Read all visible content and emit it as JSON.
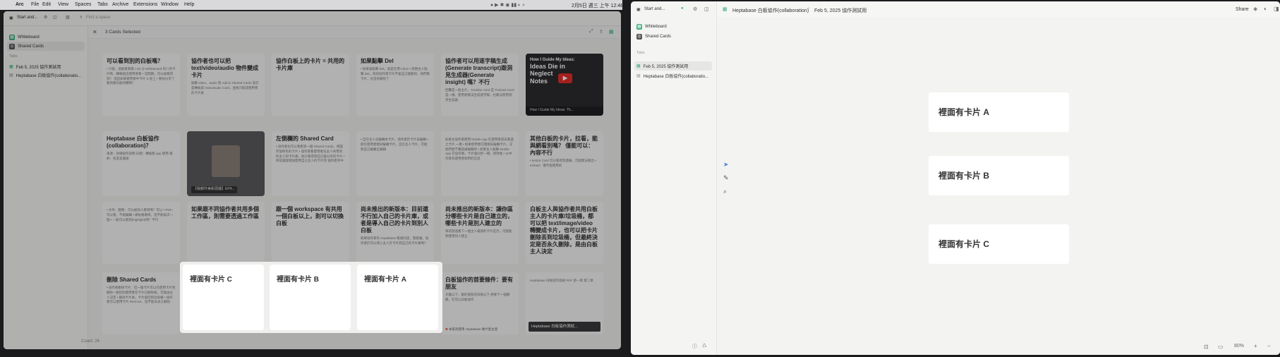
{
  "menubar": {
    "items": [
      "Arc",
      "File",
      "Edit",
      "View",
      "Spaces",
      "Tabs",
      "Archive",
      "Extensions",
      "Window",
      "Help"
    ],
    "clock": "2月5日 週三 上午 12:48"
  },
  "left": {
    "space_name": "Start and...",
    "search_placeholder": "Find a space",
    "sidebar": {
      "items": [
        "Whiteboard",
        "Shared Cards"
      ],
      "tabs_label": "Tabs",
      "tabs": [
        "Feb 5, 2025 協作測試用",
        "Heptabase 白板協作(collaboratio..."
      ]
    },
    "selection": {
      "label": "3 Cards Selected"
    },
    "footer": {
      "count": "Count: 24"
    },
    "cards": [
      {
        "t": "可以看到別的白板嗎？",
        "b": "• 只能，他能看我看 Link 分 Whiteboard 的八的卡片嗎，轉要給這使用者看 • 沒問題，可以被看得到？ 但但如果使用者中卡片 S 從上 • 要則分享了看到看白板的機嗎？"
      },
      {
        "t": "協作者也可以把 text/video/audio 物件變成卡片",
        "b": "點擊 video、audio 到 Add to Shared Cards 等於是轉換成 Video/audio Card，並後只能該使用者的卡片後"
      },
      {
        "t": "協作白板上的卡片 = 共用的卡片庫",
        "b": ""
      },
      {
        "t": "如果點擊 Del",
        "b": "• 如果會點擊 Del，就是在用 Inbox • 說明主人點擊 Del，別的協作者卡片不會自己能動別，他們看卡片，也沒有刪除了"
      },
      {
        "t": "協作者可以用逐字稿生成(Generate transcript)跟洞見生成器(Generate insight) 嗎？不行",
        "b": "回覆是一般主片，Youtube Card 是 Podcast Card 是一樣，使用者無法生成逐字稿，也無法使用洞見生成器"
      },
      {
        "t": "",
        "b": ""
      },
      {
        "t": "Heptabase 白板協作(collaboration)？",
        "b": "來源：詳細協作說明 日期：轉換看 app 使用 邀約：各友是邀請"
      },
      {
        "t": "",
        "b": ""
      },
      {
        "t": "左側欄的 Shared Card",
        "b": "• 協作者也可以看看到一個 Shared Cards，裡面存放所有的卡片 • 協作者看使用者任主人共用到的主人的卡片庫，他只看得到自己能分享的卡片 • 目前還能增加使用自己主人的卡片到 協作者手中"
      },
      {
        "t": "",
        "b": "• 自在主人也編輯本卡片，他作者於卡片白編輯 • 即在使用者相同編輯卡片，自在主人卡片，可能夠自己編輯全編輯"
      },
      {
        "t": "",
        "b": "如果主協作者使用 Mobile App 在使用者該去看過之卡片 一樣 • 如果使用者在電視白編輯卡片，又他們者不應該被編輯到 • 如果主人點擊 Mobile App 在協作者，卡片會同步一樣，修改後 • 以中作者有使用者他們的信息"
      },
      {
        "t": "其他白板的卡片，拉看，能與網看別嗎？ 僅能可以：內容不行",
        "b": "• text(or Card 可以看得到連線，可能無法看出 • embed：僅不能使用的"
      },
      {
        "t": "",
        "b": "• 文件、圖像：可以被別人看到嗎？可以 • PDF：可以看，不能編輯 • 網站看網頁，但不能再次一個 • 一般可以看到(highlight)嗎？不行"
      },
      {
        "t": "如果跟不同協作者共用多個工作區，則需要透過工作區",
        "b": ""
      },
      {
        "t": "跟一個 workspace 有共用一個白板以上，則可以切換白板",
        "b": ""
      },
      {
        "t": "尚未推出的新版本：目前還不行加入自己的卡片庫，或者是導入自己的卡片到別人白板",
        "b": "如果協作者有 Heptabase 帳號的話，我建議，協作者於可以導入主人於卡片到自己的卡片庫嗎？"
      },
      {
        "t": "尚未推出的新版本：讓你區分哪些卡片是自己建立的，哪些卡片是別人建立的",
        "b": "目前發過看下一個主人邀請的卡片是否，可能能夠使用別人建立"
      },
      {
        "t": "白板主人與協作者共用白板主人的卡片庫/垃圾桶，都可以把 text/image/video 轉變成卡片，也可以把卡片刪除丟到垃圾桶，但最終決定是否永久刪除，是由白板主人決定",
        "b": ""
      },
      {
        "t": "刪除 Shared Cards",
        "b": "• 協作者刪除卡片：但一個卡片可以在使用卡片到刪除 • 刪別別使用者在卡片已刪除後，可能由主人決定 • 刪除卡片後，卡片會回到垃圾桶 • 協作者可以使用卡片 Remove，但不能去永久刪除"
      },
      {
        "t": "",
        "b": ""
      },
      {
        "t": "",
        "b": ""
      },
      {
        "t": "",
        "b": ""
      },
      {
        "t": "白板協作的首要條件：要有朋友",
        "b": "大概以下，跟好朋友的白板以下 想要下一個網路，在可以白板協作"
      },
      {
        "t": "",
        "b": "Heptabase 白板協作測試 PDF 第一章 第二章"
      }
    ],
    "video_card": {
      "title_lines": [
        "How I Guide My Ideas:",
        "Ideas Die in",
        "Neglect",
        "Notes"
      ],
      "caption": "How I Guide My Ideas: Th..."
    },
    "video_card2": {
      "caption": "【我郵件美新頭播】EP4..."
    },
    "note_caption": "本來到使用 Heptabase 做什麼主意",
    "pdf_caption": "Heptabase 白板協作測試...",
    "popup": [
      "裡面有卡片 C",
      "裡面有卡片 B",
      "裡面有卡片 A"
    ]
  },
  "right": {
    "space_name": "Start and...",
    "sidebar": {
      "items": [
        "Whiteboard",
        "Shared Cards"
      ],
      "tabs_label": "Tabs",
      "tabs": [
        "Feb 5, 2025 協作測試用",
        "Heptabase 白板協作(collaboratio..."
      ]
    },
    "breadcrumb": [
      "Heptabase 白板協作(collaboration)",
      "Feb 5, 2025 協作測試用"
    ],
    "share": "Share",
    "cards": [
      "裡面有卡片 A",
      "裡面有卡片 B",
      "裡面有卡片 C"
    ],
    "zoom": "80%"
  },
  "colors": {
    "whiteboard_icon": "#3aaf7a",
    "shared_icon": "#555555",
    "pdf_red": "#d23a2a",
    "video_red": "#e52d27"
  }
}
